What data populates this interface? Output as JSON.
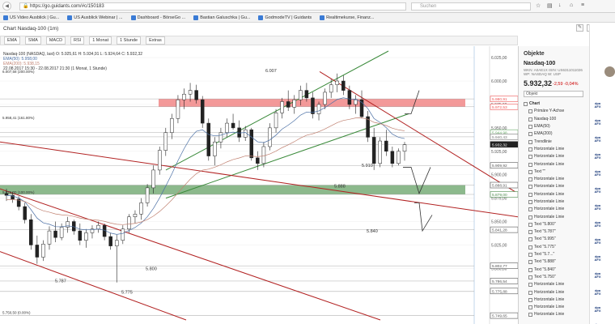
{
  "browser": {
    "url": "https://go.guidants.com/#c/150183",
    "search_placeholder": "Suchen",
    "bookmarks": [
      "US Video Ausblick | Gu...",
      "US Ausblick Webinar | ...",
      "Dashboard - BörseGo ...",
      "Bastian Galuschka | Gu...",
      "GodmodeTV | Guidants",
      "Realtimekurse, Finanz..."
    ]
  },
  "app": {
    "title": "Chart Nasdaq-100 (1m)"
  },
  "toolbar": {
    "items": [
      "EMA",
      "SMA",
      "MACD",
      "RSI",
      "1 Monat",
      "1 Stunde",
      "Extras"
    ]
  },
  "legend": {
    "line1": "Nasdaq-100 (NASDAQ, last) O: 5.925,61 H: 5.934,91 L: 5.924,64 C: 5.932,32",
    "line2": "EMA(50): 5.958,00",
    "line3": "EMA(200): 5.938,15",
    "line4": "22.08.2017 15:30 - 22.08.2017 21:30 (1 Monat, 1 Stunde)"
  },
  "chart_data": {
    "type": "candlestick",
    "y_axis_ticks": [
      "6.025,00",
      "6.000,00",
      "5.975,00",
      "5.950,00",
      "5.925,00",
      "5.900,00",
      "5.875,00",
      "5.850,00",
      "5.825,00",
      "5.800,00",
      "5.775,00",
      "5.750,00"
    ],
    "ylim": [
      5745,
      6032
    ],
    "price_tags": [
      {
        "label": "5.980,91",
        "y": 5980.91,
        "color": "#e55"
      },
      {
        "label": "5.972,53",
        "y": 5972.53,
        "color": "#e55"
      },
      {
        "label": "5.944,98",
        "y": 5944.98,
        "color": "#6a6"
      },
      {
        "label": "5.940,43",
        "y": 5940.43,
        "color": "#777"
      },
      {
        "label": "5.932,32",
        "y": 5932.32,
        "color": "#222"
      },
      {
        "label": "5.909,92",
        "y": 5909.92,
        "color": "#555"
      },
      {
        "label": "5.888,91",
        "y": 5888.91,
        "color": "#555"
      },
      {
        "label": "5.879,00",
        "y": 5879.0,
        "color": "#4a8a4a"
      },
      {
        "label": "5.841,28",
        "y": 5841.28,
        "color": "#555"
      },
      {
        "label": "5.802,77",
        "y": 5802.77,
        "color": "#555"
      },
      {
        "label": "5.786,54",
        "y": 5786.54,
        "color": "#555"
      },
      {
        "label": "5.775,88",
        "y": 5775.88,
        "color": "#555"
      },
      {
        "label": "5.749,65",
        "y": 5749.65,
        "color": "#555"
      }
    ],
    "fib_levels": [
      {
        "label": "6.007,58 (200.00%)",
        "y": 6007.58
      },
      {
        "label": "5.958,41 (161.80%)",
        "y": 5958.41
      },
      {
        "label": "5.879,00 (100.00%)",
        "y": 5879.0
      },
      {
        "label": "5.750,50 (0.00%)",
        "y": 5750.5
      }
    ],
    "annotations": [
      {
        "text": "6.007",
        "y": 6007
      },
      {
        "text": "5.910",
        "y": 5910
      },
      {
        "text": "5.888",
        "y": 5888
      },
      {
        "text": "5.840",
        "y": 5840
      },
      {
        "text": "5.800",
        "y": 5800
      },
      {
        "text": "5.787",
        "y": 5787
      },
      {
        "text": "5.775",
        "y": 5775
      }
    ],
    "zones": [
      {
        "name": "resistance",
        "from": 5972.53,
        "to": 5980.91,
        "color": "#f08080"
      },
      {
        "name": "support",
        "from": 5879.0,
        "to": 5888.91,
        "color": "#6fa86f"
      }
    ],
    "candles": [
      [
        5880,
        5885,
        5872,
        5878
      ],
      [
        5878,
        5882,
        5870,
        5874
      ],
      [
        5874,
        5877,
        5862,
        5866
      ],
      [
        5866,
        5870,
        5848,
        5852
      ],
      [
        5852,
        5858,
        5820,
        5825
      ],
      [
        5825,
        5835,
        5805,
        5812
      ],
      [
        5812,
        5830,
        5808,
        5826
      ],
      [
        5826,
        5845,
        5820,
        5840
      ],
      [
        5840,
        5850,
        5828,
        5833
      ],
      [
        5833,
        5848,
        5830,
        5844
      ],
      [
        5844,
        5855,
        5838,
        5850
      ],
      [
        5850,
        5852,
        5836,
        5840
      ],
      [
        5840,
        5848,
        5825,
        5830
      ],
      [
        5830,
        5842,
        5822,
        5838
      ],
      [
        5838,
        5846,
        5832,
        5842
      ],
      [
        5842,
        5850,
        5838,
        5846
      ],
      [
        5846,
        5848,
        5830,
        5834
      ],
      [
        5834,
        5838,
        5820,
        5824
      ],
      [
        5824,
        5836,
        5785,
        5830
      ],
      [
        5830,
        5846,
        5826,
        5842
      ],
      [
        5842,
        5858,
        5838,
        5855
      ],
      [
        5855,
        5862,
        5848,
        5858
      ],
      [
        5858,
        5875,
        5852,
        5870
      ],
      [
        5870,
        5890,
        5866,
        5886
      ],
      [
        5886,
        5910,
        5880,
        5905
      ],
      [
        5905,
        5930,
        5900,
        5926
      ],
      [
        5926,
        5950,
        5920,
        5945
      ],
      [
        5945,
        5965,
        5938,
        5960
      ],
      [
        5960,
        5985,
        5955,
        5980
      ],
      [
        5980,
        5992,
        5970,
        5986
      ],
      [
        5986,
        5998,
        5978,
        5990
      ],
      [
        5990,
        5996,
        5976,
        5980
      ],
      [
        5980,
        5984,
        5950,
        5955
      ],
      [
        5955,
        5960,
        5915,
        5920
      ],
      [
        5920,
        5940,
        5910,
        5935
      ],
      [
        5935,
        5950,
        5928,
        5945
      ],
      [
        5945,
        5960,
        5940,
        5955
      ],
      [
        5955,
        5965,
        5948,
        5950
      ],
      [
        5950,
        5958,
        5935,
        5940
      ],
      [
        5940,
        5952,
        5936,
        5948
      ],
      [
        5948,
        5950,
        5915,
        5918
      ],
      [
        5918,
        5925,
        5905,
        5912
      ],
      [
        5912,
        5935,
        5908,
        5930
      ],
      [
        5930,
        5955,
        5926,
        5950
      ],
      [
        5950,
        5970,
        5945,
        5966
      ],
      [
        5966,
        5982,
        5960,
        5978
      ],
      [
        5978,
        5990,
        5968,
        5972
      ],
      [
        5972,
        5985,
        5965,
        5980
      ],
      [
        5980,
        5995,
        5974,
        5990
      ],
      [
        5990,
        5998,
        5978,
        5982
      ],
      [
        5982,
        5988,
        5960,
        5965
      ],
      [
        5965,
        5978,
        5958,
        5975
      ],
      [
        5975,
        5992,
        5970,
        5988
      ],
      [
        5988,
        6002,
        5982,
        5996
      ],
      [
        5996,
        6008,
        5988,
        6000
      ],
      [
        6000,
        6006,
        5985,
        5990
      ],
      [
        5990,
        5995,
        5970,
        5975
      ],
      [
        5975,
        5985,
        5965,
        5980
      ],
      [
        5980,
        5990,
        5960,
        5962
      ],
      [
        5962,
        5968,
        5935,
        5940
      ],
      [
        5940,
        5950,
        5905,
        5912
      ],
      [
        5912,
        5940,
        5908,
        5936
      ],
      [
        5936,
        5948,
        5920,
        5925
      ],
      [
        5925,
        5930,
        5908,
        5912
      ],
      [
        5912,
        5928,
        5910,
        5925
      ],
      [
        5925,
        5935,
        5915,
        5932
      ]
    ],
    "current_price": "5.932,32"
  },
  "panel": {
    "title": "Objekte",
    "quote_name": "Nasdaq-100",
    "quote_meta": "WKN: A0AE1X  ISIN: US6311011026  WP: NASDAQ  W: USP",
    "quote_price": "5.932,32",
    "quote_change": "-2,59  -0,04%",
    "input_placeholder": "Objekt",
    "items": [
      "Chart",
      "Primäre Y-Achse",
      "Nasdaq-100",
      "EMA(50)",
      "EMA(200)",
      "Trendlinie",
      "Horizontale Linie",
      "Horizontale Linie",
      "Horizontale Linie",
      "Text \"\"",
      "Horizontale Linie",
      "Horizontale Linie",
      "Horizontale Linie",
      "Horizontale Linie",
      "Horizontale Linie",
      "Horizontale Linie",
      "Text \"5.800\"",
      "Text \"5.787\"",
      "Text \"5.995\"",
      "Text \"5.775\"",
      "Text \"5.7...\"",
      "Text \"5.888\"",
      "Text \"5.840\"",
      "Text \"5.750\"",
      "Horizontale Linie",
      "Horizontale Linie",
      "Horizontale Linie",
      "Horizontale Linie",
      "Horizontale Linie"
    ]
  },
  "rail": {
    "logo_top": "dpa",
    "logo_bottom": "AFX"
  },
  "colors": {
    "resistance_zone": "#f08080",
    "support_zone": "#6fa86f",
    "trend_red": "#b22222",
    "trend_green": "#3a8a3a",
    "ema50": "#4a6fa5",
    "ema200": "#c08070"
  }
}
